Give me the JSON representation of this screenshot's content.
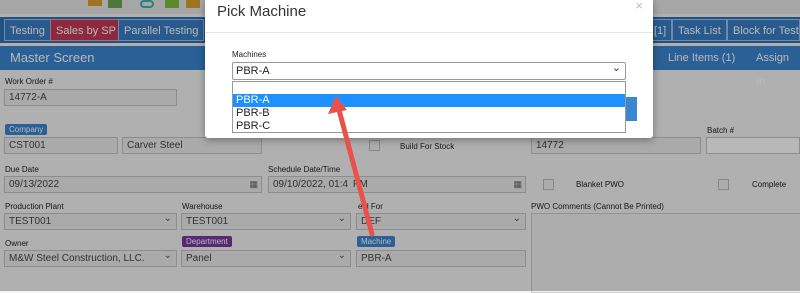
{
  "nav": {
    "tabs": [
      {
        "label": "Testing",
        "active": false
      },
      {
        "label": "Sales by SP",
        "active": true
      },
      {
        "label": "Parallel Testing",
        "active": false
      },
      {
        "label": "[1]",
        "active": false
      },
      {
        "label": "Task List",
        "active": false
      },
      {
        "label": "Block for Testing",
        "active": false
      }
    ],
    "subbar": {
      "title": "Master Screen",
      "tab_line_items": "Line Items (1)",
      "tab_assign": "Assign In"
    }
  },
  "form": {
    "work_order_label": "Work Order #",
    "work_order_value": "14772-A",
    "company_label": "Company",
    "company_code": "CST001",
    "company_name": "Carver Steel",
    "build_for_stock_label": "Build For Stock",
    "order_value": "14772",
    "batch_label": "Batch #",
    "due_date_label": "Due Date",
    "due_date_value": "09/13/2022",
    "schedule_label": "Schedule Date/Time",
    "schedule_value": "09/10/2022, 01:4",
    "schedule_value_suffix": "PM",
    "blanket_pwo_label": "Blanket PWO",
    "complete_label": "Complete",
    "production_plant_label": "Production Plant",
    "production_plant_value": "TEST001",
    "warehouse_label": "Warehouse",
    "warehouse_value": "TEST001",
    "held_for_label": "eld For",
    "held_for_value": "DEF",
    "pwo_comments_label": "PWO Comments (Cannot Be Printed)",
    "owner_label": "Owner",
    "owner_value": "M&W Steel Construction, LLC.",
    "department_label": "Department",
    "department_value": "Panel",
    "machine_label": "Machine",
    "machine_value": "PBR-A"
  },
  "modal": {
    "title": "Pick Machine",
    "close": "×",
    "machines_label": "Machines",
    "selected": "PBR-A",
    "options": [
      "PBR-A",
      "PBR-B",
      "PBR-C"
    ]
  },
  "colors": {
    "accent": "#3b86cf",
    "active_tab": "#c23a56",
    "highlight": "#1e90ff",
    "arrow": "#e8524a"
  }
}
